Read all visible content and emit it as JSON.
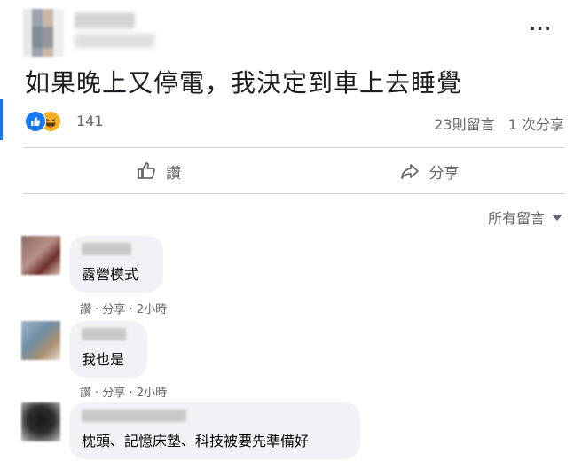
{
  "post": {
    "text": "如果晚上又停電，我決定到車上去睡覺",
    "more_icon": "···",
    "reaction_count": "141",
    "comment_count": "23則留言",
    "share_count": "1 次分享"
  },
  "actions": {
    "like_label": "讚",
    "share_label": "分享"
  },
  "comments_sort_label": "所有留言",
  "comments": [
    {
      "text": "露營模式",
      "like": "讚",
      "sep1": " · ",
      "reply": "分享",
      "sep2": " · ",
      "time": "2小時"
    },
    {
      "text": "我也是",
      "like": "讚",
      "sep1": " · ",
      "reply": "分享",
      "sep2": " · ",
      "time": "2小時"
    },
    {
      "text": "枕頭、記憶床墊、科技被要先準備好"
    }
  ],
  "colors": {
    "accent": "#1877f2",
    "haha": "#f7b125",
    "secondary_text": "#65676b",
    "bubble": "#f0f2f5"
  }
}
